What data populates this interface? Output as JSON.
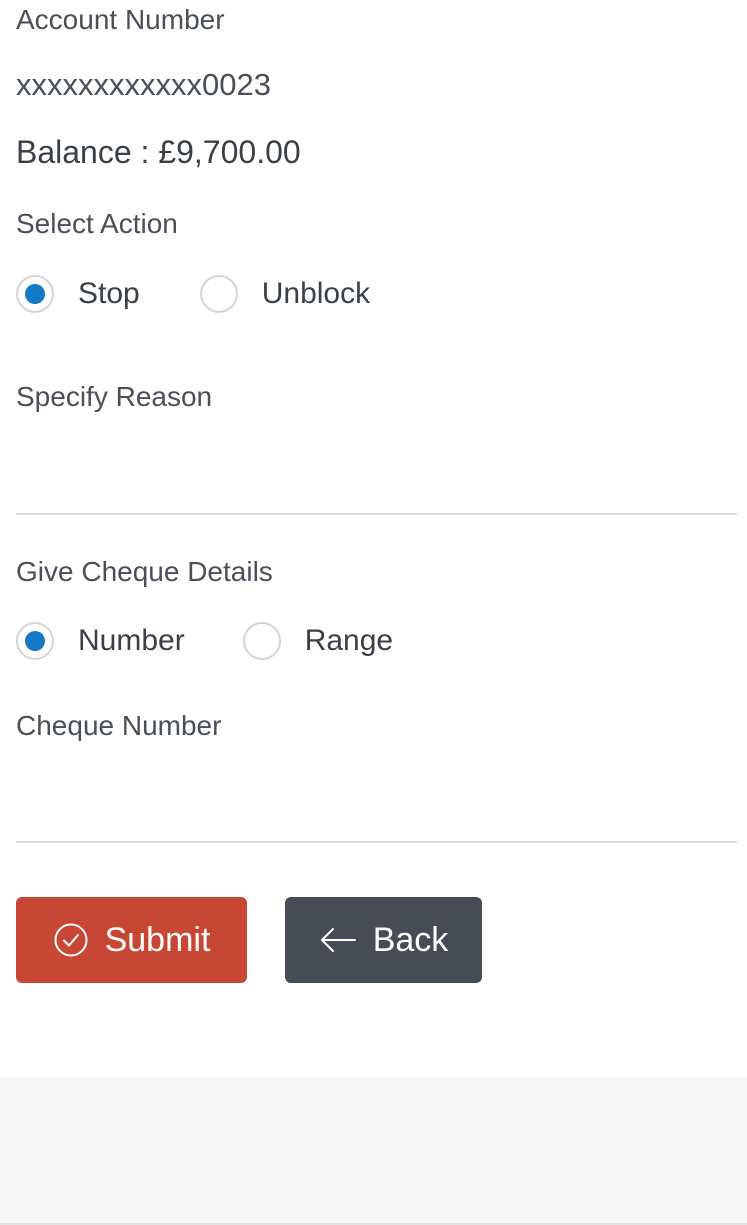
{
  "account": {
    "number_label": "Account Number",
    "number_value": "xxxxxxxxxxxx0023",
    "balance_text": "Balance : £9,700.00"
  },
  "action": {
    "label": "Select Action",
    "options": [
      "Stop",
      "Unblock"
    ],
    "selected": "Stop"
  },
  "reason": {
    "label": "Specify Reason",
    "value": ""
  },
  "cheque_details": {
    "label": "Give Cheque Details",
    "options": [
      "Number",
      "Range"
    ],
    "selected": "Number"
  },
  "cheque_number": {
    "label": "Cheque Number",
    "value": ""
  },
  "buttons": {
    "submit_label": "Submit",
    "back_label": "Back"
  },
  "icons": {
    "submit": "check-circle-icon",
    "back": "arrow-left-icon"
  },
  "colors": {
    "radio_selected": "#1479c6",
    "submit_bg": "#c84634",
    "back_bg": "#474b56"
  }
}
